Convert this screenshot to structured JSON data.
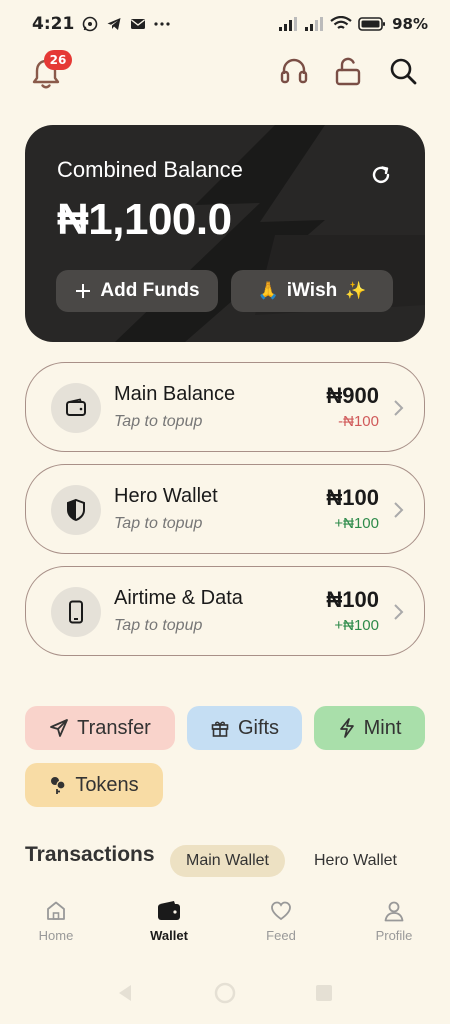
{
  "status_bar": {
    "time": "4:21",
    "battery": "98%"
  },
  "top_bar": {
    "notification_count": "26"
  },
  "balance_card": {
    "title": "Combined Balance",
    "amount": "₦1,100.0",
    "add_funds_label": "Add Funds",
    "iwish_label": "iWish",
    "iwish_prefix_emoji": "🙏",
    "iwish_suffix_emoji": "✨"
  },
  "wallets": [
    {
      "name": "Main Balance",
      "subtitle": "Tap to topup",
      "amount": "₦900",
      "change": "-₦100",
      "icon": "wallet-icon"
    },
    {
      "name": "Hero Wallet",
      "subtitle": "Tap to topup",
      "amount": "₦100",
      "change": "+₦100",
      "icon": "shield-icon"
    },
    {
      "name": "Airtime & Data",
      "subtitle": "Tap to topup",
      "amount": "₦100",
      "change": "+₦100",
      "icon": "phone-icon"
    }
  ],
  "actions": [
    {
      "label": "Transfer",
      "icon": "send-icon",
      "color": "#f9d3cb"
    },
    {
      "label": "Gifts",
      "icon": "gift-icon",
      "color": "#c5def3"
    },
    {
      "label": "Mint",
      "icon": "bolt-icon",
      "color": "#a9dfaa"
    },
    {
      "label": "Tokens",
      "icon": "coins-icon",
      "color": "#f8dca5"
    }
  ],
  "transactions": {
    "title": "Transactions",
    "tabs": [
      "Main Wallet",
      "Hero Wallet"
    ],
    "active_tab": "Main Wallet"
  },
  "bottom_nav": {
    "items": [
      "Home",
      "Wallet",
      "Feed",
      "Profile"
    ],
    "active": "Wallet"
  },
  "colors": {
    "background": "#fbf6e9",
    "card": "#282726",
    "notification_badge": "#e53935",
    "negative": "#d05a5a",
    "positive": "#2e8b4a"
  }
}
